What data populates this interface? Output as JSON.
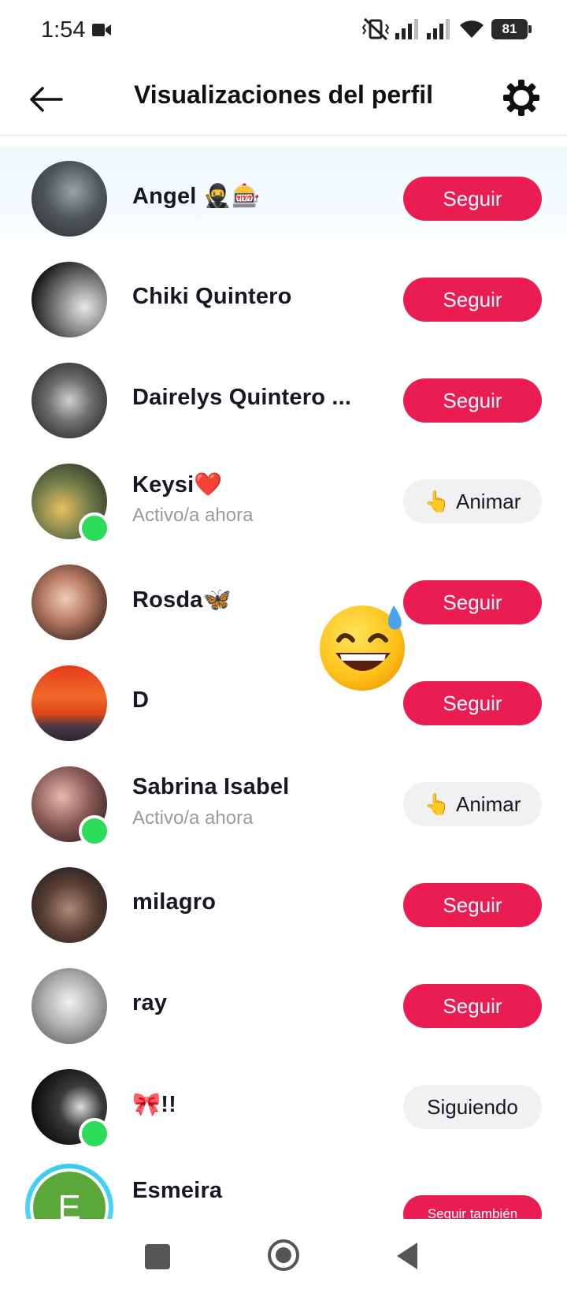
{
  "status_bar": {
    "time": "1:54",
    "battery": "81",
    "icons": [
      "video-camera-icon",
      "vibrate-icon",
      "signal-icon",
      "signal-icon",
      "wifi-icon",
      "battery-icon"
    ]
  },
  "header": {
    "title": "Visualizaciones del perfil",
    "back_icon": "arrow-left-icon",
    "settings_icon": "gear-icon"
  },
  "viewers": [
    {
      "name": "Angel",
      "emoji": "🥷🎰",
      "subtitle": "",
      "action": "Seguir",
      "online": false
    },
    {
      "name": "Chiki Quintero",
      "emoji": "",
      "subtitle": "",
      "action": "Seguir",
      "online": false
    },
    {
      "name": "Dairelys Quintero ...",
      "emoji": "",
      "subtitle": "",
      "action": "Seguir",
      "online": false
    },
    {
      "name": "Keysi",
      "emoji": "❤️",
      "subtitle": "Activo/a ahora",
      "action": "Animar",
      "online": true
    },
    {
      "name": "Rosda",
      "emoji": "🦋",
      "subtitle": "",
      "action": "Seguir",
      "online": false
    },
    {
      "name": "D",
      "emoji": "",
      "subtitle": "",
      "action": "Seguir",
      "online": false
    },
    {
      "name": "Sabrina Isabel",
      "emoji": "",
      "subtitle": "Activo/a ahora",
      "action": "Animar",
      "online": true
    },
    {
      "name": "milagro",
      "emoji": "",
      "subtitle": "",
      "action": "Seguir",
      "online": false
    },
    {
      "name": "ray",
      "emoji": "",
      "subtitle": "",
      "action": "Seguir",
      "online": false
    },
    {
      "name": "",
      "emoji": "🎀!!",
      "subtitle": "",
      "action": "Siguiendo",
      "online": true
    },
    {
      "name": "Esmeira",
      "emoji": "",
      "subtitle": "",
      "action": "Seguir también",
      "online": false,
      "initial": "E"
    }
  ],
  "cheer_emoji": "👆",
  "floating_emoji": "grinning-sweat-emoji",
  "colors": {
    "accent": "#ea1d53",
    "online": "#2ddb5a",
    "secondary_button": "#f1f1f2"
  },
  "nav_bar": {
    "icons": [
      "recent-apps-icon",
      "home-icon",
      "back-icon"
    ]
  }
}
